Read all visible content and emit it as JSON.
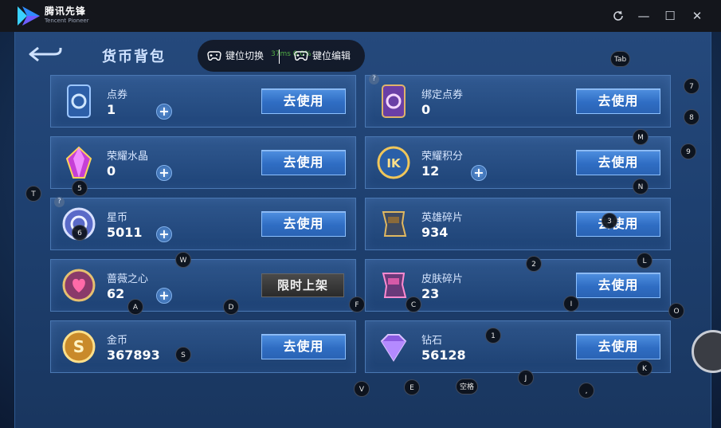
{
  "app": {
    "name_cn": "腾讯先锋",
    "name_en": "Tencent Pioneer"
  },
  "window": {
    "refresh_icon": "refresh-icon",
    "min": "—",
    "max": "☐",
    "close": "✕"
  },
  "header": {
    "title": "货币背包"
  },
  "keybar": {
    "switch_label": "键位切换",
    "edit_label": "键位编辑",
    "ping": "37ms 0.0%"
  },
  "currencies": [
    {
      "name": "点券",
      "value": "1",
      "plus": "+",
      "action": "去使用"
    },
    {
      "name": "绑定点券",
      "value": "0",
      "action": "去使用",
      "q": "?"
    },
    {
      "name": "荣耀水晶",
      "value": "0",
      "plus": "+",
      "action": "去使用"
    },
    {
      "name": "荣耀积分",
      "value": "12",
      "plus": "+",
      "action": "去使用"
    },
    {
      "name": "星币",
      "value": "5011",
      "plus": "+",
      "action": "去使用",
      "q": "?"
    },
    {
      "name": "英雄碎片",
      "value": "934",
      "action": "去使用"
    },
    {
      "name": "蔷薇之心",
      "value": "62",
      "plus": "+",
      "action": "限时上架"
    },
    {
      "name": "皮肤碎片",
      "value": "23",
      "action": "去使用"
    },
    {
      "name": "金币",
      "value": "367893",
      "action": "去使用"
    },
    {
      "name": "钻石",
      "value": "56128",
      "action": "去使用"
    }
  ],
  "keys": [
    "Tab",
    "7",
    "8",
    "M",
    "9",
    "T",
    "5",
    "N",
    "6",
    "3",
    "W",
    "2",
    "L",
    "A",
    "D",
    "F",
    "C",
    "I",
    "O",
    "1",
    "S",
    "J",
    "K",
    "V",
    "E",
    "空格",
    ","
  ],
  "colors": {
    "accent": "#2f6dc3",
    "panel": "#1e4070",
    "titlebar": "#14161c"
  }
}
